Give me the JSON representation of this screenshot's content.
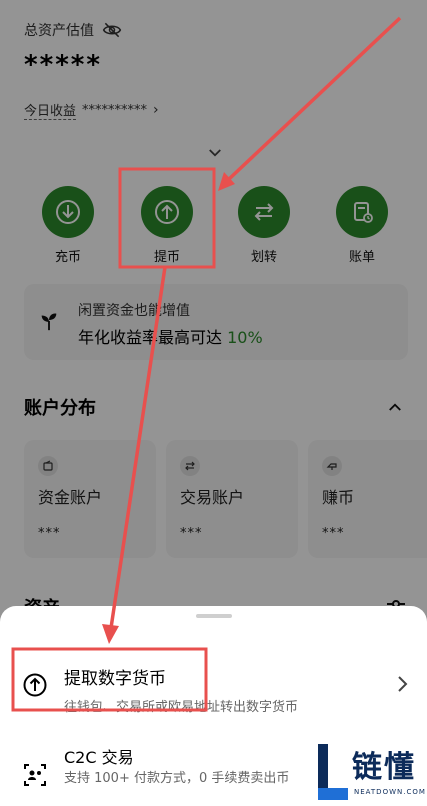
{
  "header": {
    "total_assets_label": "总资产估值",
    "total_assets_value": "*****",
    "today_label": "今日收益",
    "today_value": "**********"
  },
  "actions": [
    {
      "label": "充币",
      "icon": "deposit-arrow-icon"
    },
    {
      "label": "提币",
      "icon": "withdraw-arrow-icon"
    },
    {
      "label": "划转",
      "icon": "transfer-icon"
    },
    {
      "label": "账单",
      "icon": "bill-icon"
    }
  ],
  "promo": {
    "line1": "闲置资金也能增值",
    "line2_prefix": "年化收益率最高可达 ",
    "line2_pct": "10%"
  },
  "account_distribution": {
    "title": "账户分布",
    "cards": [
      {
        "name": "资金账户",
        "value": "***"
      },
      {
        "name": "交易账户",
        "value": "***"
      },
      {
        "name": "赚币",
        "value": "***"
      }
    ]
  },
  "assets_section": {
    "title": "资产"
  },
  "sheet": {
    "option1_title": "提取数字货币",
    "option1_sub": "往钱包、交易所或欧易地址转出数字货币",
    "option2_title": "C2C 交易",
    "option2_sub": "支持 100+ 付款方式，0 手续费卖出币"
  },
  "watermark": {
    "main": "链懂",
    "sub": "NEATDOWN.COM"
  },
  "colors": {
    "accent_green": "#2b8a2b",
    "annotation_red": "#e8504e"
  }
}
